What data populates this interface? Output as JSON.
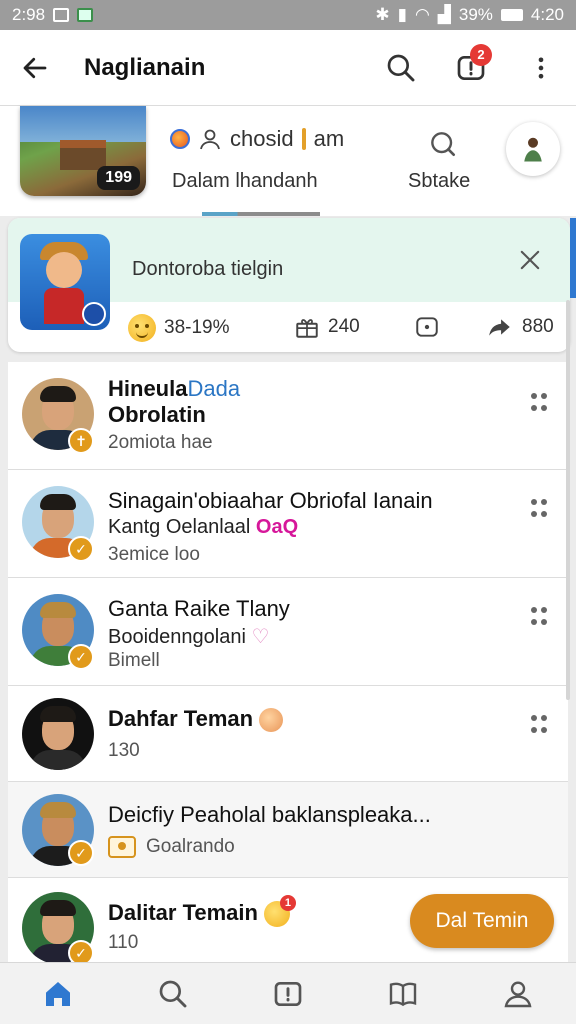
{
  "status_bar": {
    "left_text": "2:98",
    "battery": "39%",
    "time": "4:20"
  },
  "app_bar": {
    "title": "Naglianain",
    "notification_count": "2"
  },
  "top_strip": {
    "game_count": "199",
    "user_text": "chosid",
    "user_suffix": "am",
    "sub_label": "Dalam lhandanh",
    "search_label": "Sbtake"
  },
  "feature_card": {
    "title": "Dontoroba tielgin",
    "stat_percent": "38-19%",
    "stat_count": "240",
    "stat_share": "880"
  },
  "friends": [
    {
      "name": "Hineula",
      "name_highlight": "Dada",
      "line2": "Obrolatin",
      "line3": "2omiota hae",
      "badge": "✝"
    },
    {
      "name": "Sinagain'obiaahar Obriofal Ianain",
      "line2": "Kantg Oelanlaal",
      "line2_tag": "OaQ",
      "line3": "3emice loo",
      "badge": "✓"
    },
    {
      "name": "Ganta Raike Tlany",
      "line2": "Booidenngolani",
      "line3": "Bimell",
      "badge": "✓"
    },
    {
      "name": "Dahfar Teman",
      "line2": "130"
    },
    {
      "name": "Deicfiy Peaholal baklanspleaka...",
      "line2": "Goalrando",
      "badge": "✓"
    },
    {
      "name": "Dalitar Temain",
      "line2": "110",
      "badge": "✓",
      "emoji_badge": "1"
    }
  ],
  "cta_label": "Dal Temin",
  "bottom_nav": [
    "home-icon",
    "search-icon",
    "alert-icon",
    "book-icon",
    "profile-icon"
  ],
  "colors": {
    "accent": "#d98a1f",
    "badge_red": "#e53935",
    "card_bg": "#e4f6ee",
    "link_blue": "#2b76c4",
    "nav_active": "#2f78d0"
  }
}
